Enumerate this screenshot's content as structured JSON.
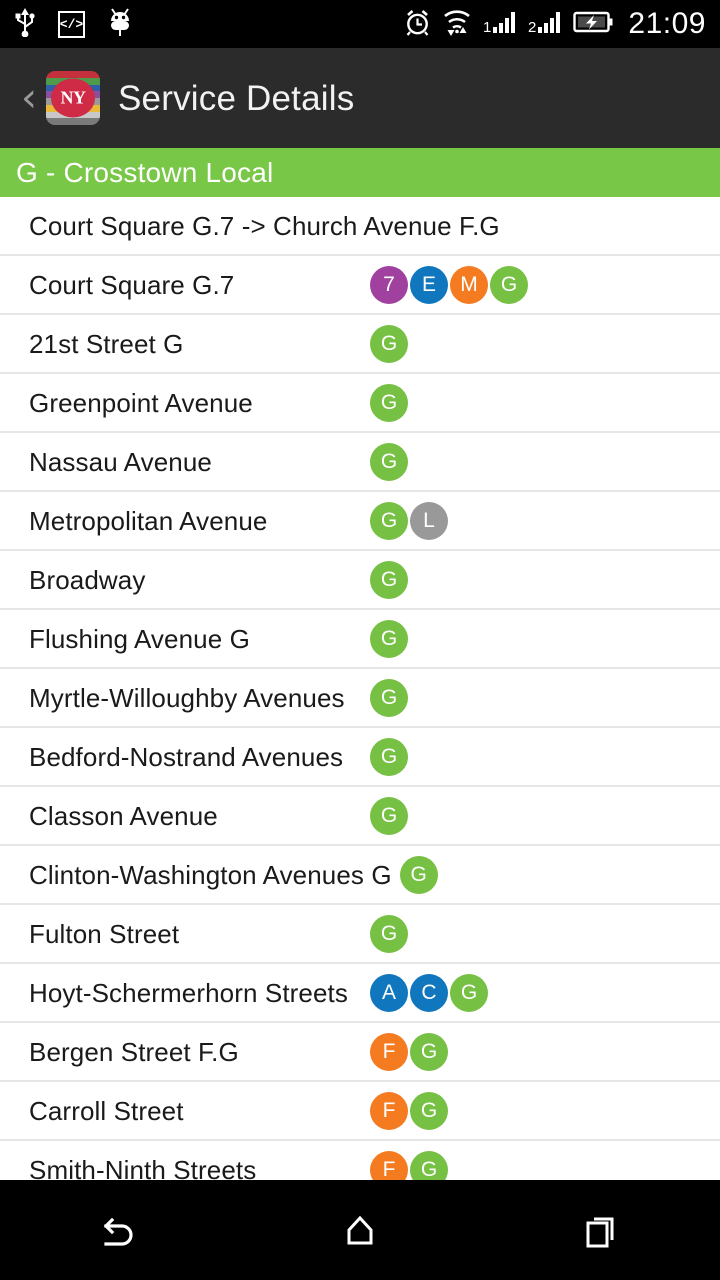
{
  "status_bar": {
    "icons_left": [
      "usb-icon",
      "developer-mode-icon",
      "android-debug-icon"
    ],
    "developer_glyph": "</>",
    "icons_right": [
      "alarm-icon",
      "wifi-icon",
      "signal-sim1-icon",
      "signal-sim2-icon",
      "battery-charging-icon"
    ],
    "clock": "21:09"
  },
  "action_bar": {
    "back_chevron": "‹",
    "logo_text": "NY",
    "logo_stripe_colors": [
      "#c4303c",
      "#4f9b4b",
      "#2f5fa8",
      "#8c4fa0",
      "#9a9a9a",
      "#e8b93a",
      "#c8c8c8",
      "#7a7a7a"
    ],
    "title": "Service Details"
  },
  "route_header": {
    "title": "G - Crosstown Local",
    "color": "#78c746"
  },
  "direction_row": {
    "text": "Court Square G.7 -> Church Avenue F.G"
  },
  "line_colors": {
    "7": "#a0409f",
    "E": "#1076bd",
    "M": "#f47b20",
    "G": "#76c043",
    "L": "#999999",
    "A": "#1076bd",
    "C": "#1076bd",
    "F": "#f47b20"
  },
  "stations": [
    {
      "name": "Court Square G.7",
      "lines": [
        "7",
        "E",
        "M",
        "G"
      ]
    },
    {
      "name": "21st Street G",
      "lines": [
        "G"
      ]
    },
    {
      "name": "Greenpoint Avenue",
      "lines": [
        "G"
      ]
    },
    {
      "name": "Nassau Avenue",
      "lines": [
        "G"
      ]
    },
    {
      "name": "Metropolitan Avenue",
      "lines": [
        "G",
        "L"
      ]
    },
    {
      "name": "Broadway",
      "lines": [
        "G"
      ]
    },
    {
      "name": "Flushing Avenue G",
      "lines": [
        "G"
      ]
    },
    {
      "name": "Myrtle-Willoughby Avenues",
      "lines": [
        "G"
      ]
    },
    {
      "name": "Bedford-Nostrand Avenues",
      "lines": [
        "G"
      ]
    },
    {
      "name": "Classon Avenue",
      "lines": [
        "G"
      ]
    },
    {
      "name": "Clinton-Washington Avenues G",
      "lines": [
        "G"
      ]
    },
    {
      "name": "Fulton Street",
      "lines": [
        "G"
      ]
    },
    {
      "name": "Hoyt-Schermerhorn Streets",
      "lines": [
        "A",
        "C",
        "G"
      ]
    },
    {
      "name": "Bergen Street F.G",
      "lines": [
        "F",
        "G"
      ]
    },
    {
      "name": "Carroll Street",
      "lines": [
        "F",
        "G"
      ]
    },
    {
      "name": "Smith-Ninth Streets",
      "lines": [
        "F",
        "G"
      ]
    }
  ],
  "nav_bar": {
    "buttons": [
      "back-nav-button",
      "home-nav-button",
      "recents-nav-button"
    ]
  }
}
